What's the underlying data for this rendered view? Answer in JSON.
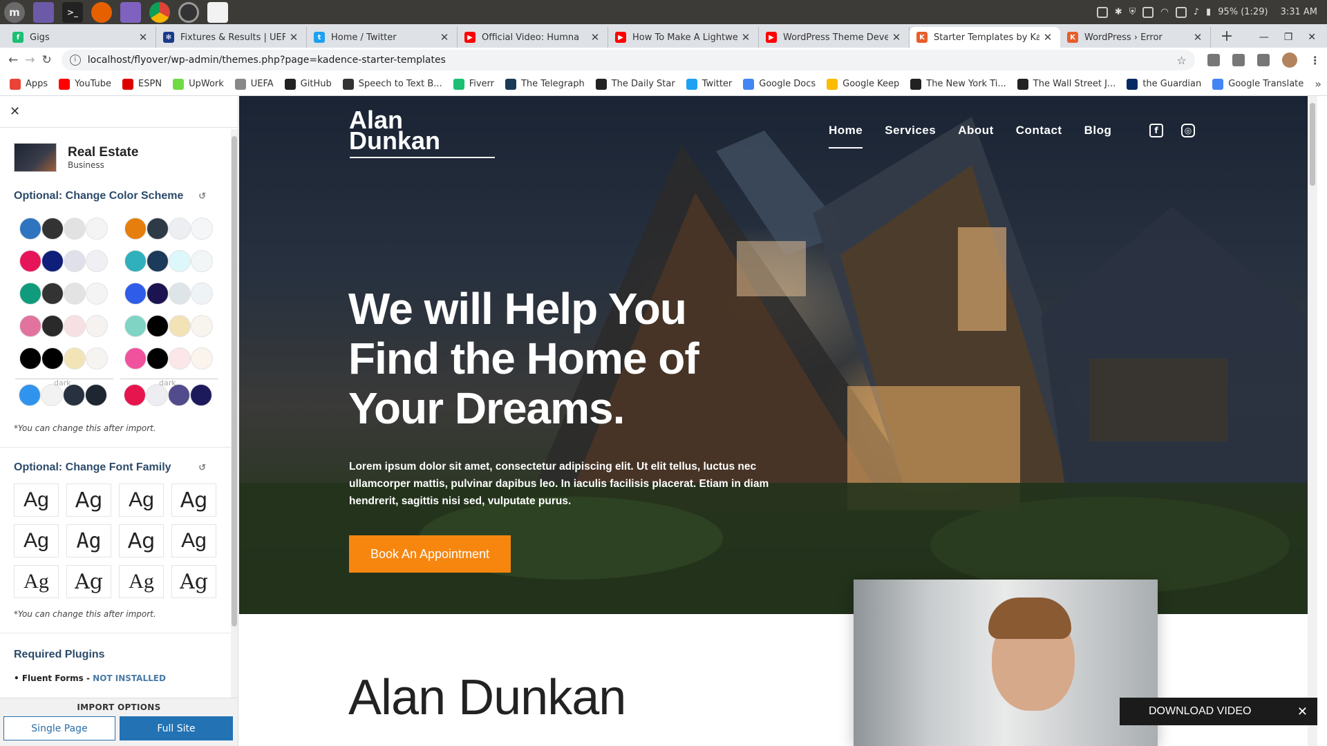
{
  "taskbar": {
    "apps": [
      "mint-menu-icon",
      "window-list-icon",
      "terminal-icon",
      "firefox-icon",
      "files-icon",
      "chrome-icon",
      "camera-icon",
      "text-editor-icon"
    ],
    "battery": "95% (1:29)",
    "clock": "3:31 AM"
  },
  "tabs": [
    {
      "title": "Gigs",
      "color": "#1dbf73",
      "glyph": "f"
    },
    {
      "title": "Fixtures & Results | UEFA",
      "color": "#1a3a8a",
      "glyph": "✻"
    },
    {
      "title": "Home / Twitter",
      "color": "#1da1f2",
      "glyph": "t"
    },
    {
      "title": "Official Video: Humna",
      "color": "#ff0000",
      "glyph": "▶"
    },
    {
      "title": "How To Make A Lightweig",
      "color": "#ff0000",
      "glyph": "▶"
    },
    {
      "title": "WordPress Theme Develo",
      "color": "#ff0000",
      "glyph": "▶"
    },
    {
      "title": "Starter Templates by Kad",
      "color": "#e85d2c",
      "glyph": "K"
    },
    {
      "title": "WordPress › Error",
      "color": "#e85d2c",
      "glyph": "K"
    }
  ],
  "address": {
    "url": "localhost/flyover/wp-admin/themes.php?page=kadence-starter-templates"
  },
  "bookmarks": [
    {
      "label": "Apps",
      "color": "#ea4335"
    },
    {
      "label": "YouTube",
      "color": "#ff0000"
    },
    {
      "label": "ESPN",
      "color": "#d00"
    },
    {
      "label": "UpWork",
      "color": "#6fda44"
    },
    {
      "label": "UEFA",
      "color": "#888"
    },
    {
      "label": "GitHub",
      "color": "#222"
    },
    {
      "label": "Speech to Text B...",
      "color": "#333"
    },
    {
      "label": "Fiverr",
      "color": "#1dbf73"
    },
    {
      "label": "The Telegraph",
      "color": "#1b3a57"
    },
    {
      "label": "The Daily Star",
      "color": "#222"
    },
    {
      "label": "Twitter",
      "color": "#1da1f2"
    },
    {
      "label": "Google Docs",
      "color": "#4285f4"
    },
    {
      "label": "Google Keep",
      "color": "#fbbc04"
    },
    {
      "label": "The New York Ti...",
      "color": "#222"
    },
    {
      "label": "The Wall Street J...",
      "color": "#222"
    },
    {
      "label": "the Guardian",
      "color": "#052962"
    },
    {
      "label": "Google Translate",
      "color": "#4285f4"
    }
  ],
  "panel": {
    "close": "✕",
    "template_name": "Real Estate",
    "template_category": "Business",
    "color_title": "Optional: Change Color Scheme",
    "palettes": [
      [
        "#2e74c0",
        "#333333",
        "#e2e2e2",
        "#f4f4f4"
      ],
      [
        "#e67e0d",
        "#2f3a47",
        "#eceef2",
        "#f5f6f8"
      ],
      [
        "#e6155a",
        "#0e1e7a",
        "#dfe0ea",
        "#f0f0f4"
      ],
      [
        "#2fb0bc",
        "#1c3a5a",
        "#dcf8fb",
        "#f2f6f7"
      ],
      [
        "#109c7c",
        "#333333",
        "#e3e3e3",
        "#f4f4f4"
      ],
      [
        "#2f5ce8",
        "#1b1450",
        "#dde5e9",
        "#eef3f6"
      ],
      [
        "#e2739e",
        "#2a2a2a",
        "#f7e0e3",
        "#f5f2f0"
      ],
      [
        "#7fd4c4",
        "#000000",
        "#f3e2b5",
        "#f8f5ee"
      ],
      [
        "#000000",
        "#000000",
        "#f3e4b7",
        "#f6f4f0"
      ],
      [
        "#f0529e",
        "#000000",
        "#fbe6ea",
        "#fbf4ec"
      ]
    ],
    "dark_palettes": [
      [
        "#3094ee",
        "#f2f2f2",
        "#27313f",
        "#1e2632"
      ],
      [
        "#e6154d",
        "#ededf2",
        "#524b8c",
        "#1d1a5c"
      ]
    ],
    "dark_label": "dark",
    "note": "*You can change this after import.",
    "font_title": "Optional: Change Font Family",
    "font_sample": "Ag",
    "required_title": "Required Plugins",
    "plugin_name": "Fluent Forms - ",
    "plugin_status": "NOT INSTALLED",
    "import_label": "IMPORT OPTIONS",
    "single_page": "Single Page",
    "full_site": "Full Site"
  },
  "site": {
    "logo_line1": "Alan",
    "logo_line2": "Dunkan",
    "nav": [
      "Home",
      "Services",
      "About",
      "Contact",
      "Blog"
    ],
    "headline": "We will Help You Find the Home of Your Dreams.",
    "lead": "Lorem ipsum dolor sit amet, consectetur adipiscing elit. Ut elit tellus, luctus nec ullamcorper mattis, pulvinar dapibus leo. In iaculis facilisis placerat. Etiam in diam hendrerit, sagittis nisi sed, vulputate purus.",
    "cta": "Book An Appointment",
    "section_title": "Alan Dunkan"
  },
  "overlay": {
    "download_video": "DOWNLOAD VIDEO"
  }
}
